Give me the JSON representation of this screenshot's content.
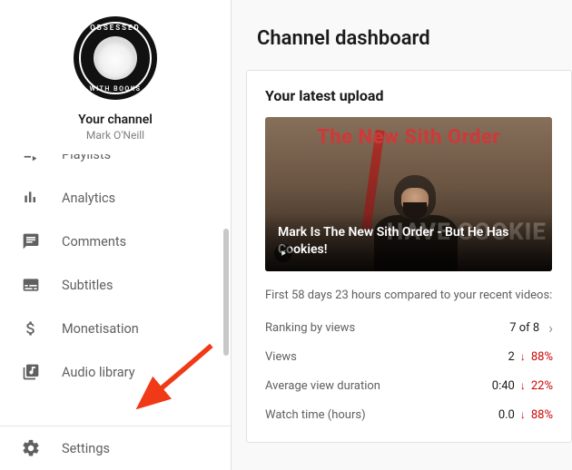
{
  "sidebar": {
    "avatar_top": "OBSESSED",
    "avatar_bottom": "WITH BOOKS",
    "your_channel_label": "Your channel",
    "channel_name": "Mark O'Neill",
    "items": [
      {
        "label": "Playlists",
        "icon": "playlist-icon"
      },
      {
        "label": "Analytics",
        "icon": "analytics-icon"
      },
      {
        "label": "Comments",
        "icon": "comments-icon"
      },
      {
        "label": "Subtitles",
        "icon": "subtitles-icon"
      },
      {
        "label": "Monetisation",
        "icon": "monetisation-icon"
      },
      {
        "label": "Audio library",
        "icon": "audio-library-icon"
      }
    ],
    "settings_label": "Settings"
  },
  "main": {
    "title": "Channel dashboard",
    "latest_upload": {
      "heading": "Your latest upload",
      "sith_banner": "The New Sith Order",
      "ghost_text": "HAVE COOKIE",
      "video_title": "Mark Is The New Sith Order - But He Has Cookies!",
      "compare_text": "First 58 days 23 hours compared to your recent videos:",
      "stats": [
        {
          "label": "Ranking by views",
          "value": "7 of 8",
          "delta": null,
          "chevron": true
        },
        {
          "label": "Views",
          "value": "2",
          "delta": "88%",
          "chevron": false
        },
        {
          "label": "Average view duration",
          "value": "0:40",
          "delta": "22%",
          "chevron": false
        },
        {
          "label": "Watch time (hours)",
          "value": "0.0",
          "delta": "88%",
          "chevron": false
        }
      ]
    }
  }
}
